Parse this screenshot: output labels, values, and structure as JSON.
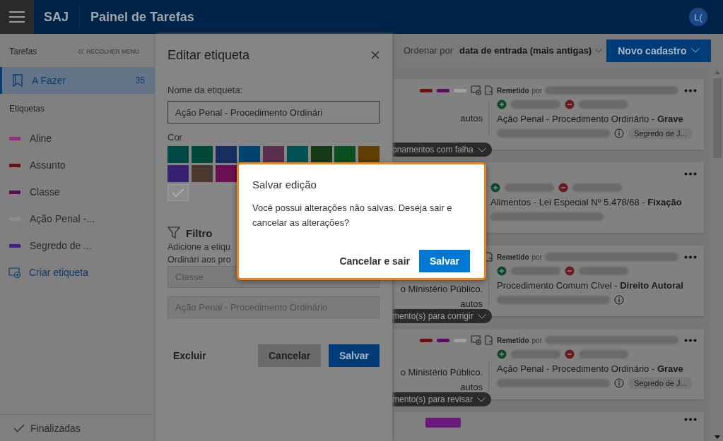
{
  "header": {
    "app": "SAJ",
    "title": "Painel de Tarefas",
    "avatar": "L("
  },
  "sidebar": {
    "heading": "Tarefas",
    "collapse": "RECOLHER MENU",
    "tasks": [
      {
        "label": "A Fazer",
        "count": "35",
        "selected": true
      }
    ],
    "tags_heading": "Etiquetas",
    "tags": [
      {
        "label": "Aline",
        "color": "#9c2a7c"
      },
      {
        "label": "Assunto",
        "color": "#6e1010"
      },
      {
        "label": "Classe",
        "color": "#5e0a60"
      },
      {
        "label": "Ação Penal -...",
        "color": "#8c8c8c"
      },
      {
        "label": "Segredo de ...",
        "color": "#4a1a8c"
      }
    ],
    "create": "Criar etiqueta",
    "footer": "Finalizadas"
  },
  "toolbar": {
    "sort_prefix": "Ordenar por",
    "sort_value": "data de entrada (mais antigas)",
    "new_button": "Novo cadastro"
  },
  "cards": [
    {
      "tags": [
        {
          "color": "#6e1010"
        },
        {
          "color": "#5e0a60"
        },
        {
          "color": "#a0a0a0"
        }
      ],
      "icons": [
        {
          "kind": "tag-add"
        },
        {
          "kind": "document"
        }
      ],
      "sender": {
        "label": "Remetido",
        "by": "por"
      },
      "left": [
        "autos"
      ],
      "subject": "Ação Penal - Procedimento Ordinário - **Grave**",
      "info": true,
      "badge": "Segredo de J...",
      "pill": "onamentos com falha"
    },
    {
      "subject": "Alimentos - Lei Especial Nº 5.478/68 - **Fixação**"
    },
    {
      "icons": [
        {
          "kind": "document"
        }
      ],
      "sender": {
        "label": "Remetido",
        "by": "por"
      },
      "left": [
        "o Ministério Público.",
        "autos"
      ],
      "subject": "Procedimento Comum Cível - **Direito Autoral**",
      "info": true,
      "pill": "mento(s) para corrigir"
    },
    {
      "tags": [
        {
          "color": "#6e1010"
        },
        {
          "color": "#5e0a60"
        },
        {
          "color": "#a0a0a0"
        }
      ],
      "icons": [
        {
          "kind": "tag-add"
        },
        {
          "kind": "document"
        }
      ],
      "sender": {
        "label": "Remetido",
        "by": "por"
      },
      "left": [
        "o Ministério Público.",
        "autos"
      ],
      "subject": "Ação Penal - Procedimento Ordinário - **Grave**",
      "info": true,
      "badge": "Segredo de J...",
      "pill": "mento(s) para revisar"
    },
    {
      "kind": "partial",
      "chip": {
        "color": "#6a1a7a"
      }
    }
  ],
  "editor": {
    "title": "Editar etiqueta",
    "name_label": "Nome da etiqueta:",
    "name_value": "Ação Penal - Procedimento Ordinári",
    "color_label": "Cor",
    "color_rows": [
      [
        {
          "color": "#004848",
          "selected": false
        },
        {
          "color": "#00483a",
          "selected": false
        },
        {
          "color": "#172f5e",
          "selected": false
        },
        {
          "color": "#00436e",
          "selected": false
        },
        {
          "color": "#5a3050",
          "selected": false
        },
        {
          "color": "#005255",
          "selected": false
        },
        {
          "color": "#173a17",
          "selected": false
        },
        {
          "color": "#0a5020",
          "selected": false
        },
        {
          "color": "#603d00",
          "selected": false
        }
      ],
      [
        {
          "color": "#3a2070",
          "selected": false
        },
        {
          "color": "#4a3830",
          "selected": false
        },
        {
          "color": "#6a1050",
          "selected": false
        }
      ],
      [
        {
          "color": "#8c8c8c",
          "selected": true
        }
      ]
    ],
    "filter_title": "Filtro",
    "filter_lines": [
      "Adicione a etiqu",
      "Ordinári aos pro"
    ],
    "select_placeholder": "Classe",
    "value_placeholder": "Ação Penal - Procedimento Ordinário",
    "delete": "Excluir",
    "cancel": "Cancelar",
    "save": "Salvar"
  },
  "dialog": {
    "title": "Salvar edição",
    "message": "Você possui alterações não salvas. Deseja sair e cancelar as alterações?",
    "cancel": "Cancelar e sair",
    "save": "Salvar"
  }
}
